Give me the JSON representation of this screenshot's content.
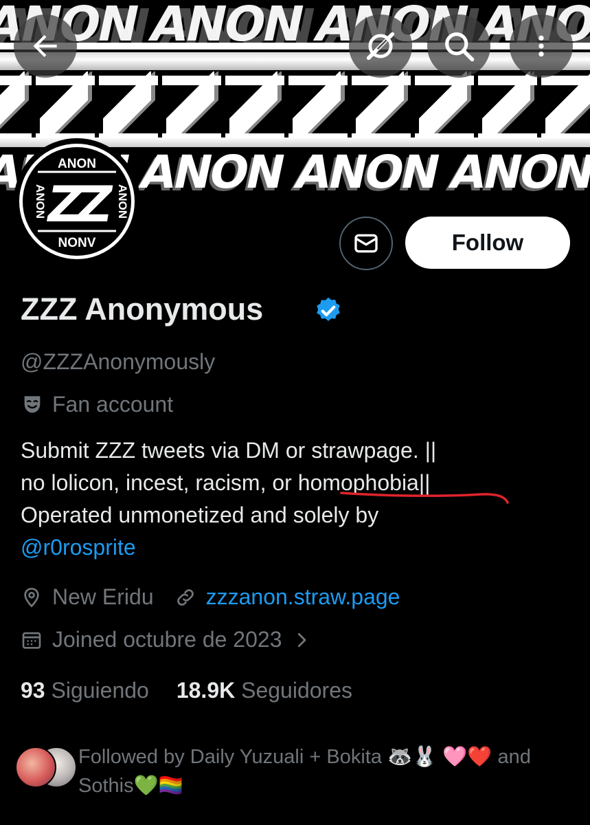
{
  "banner": {
    "top_text": "ANON ANON ANON ANON",
    "bottom_text": "ANON ANON ANON ANON"
  },
  "nav": {
    "back_icon": "arrow-left-icon",
    "grok_icon": "grok-icon",
    "search_icon": "search-icon",
    "more_icon": "more-vertical-icon"
  },
  "avatar": {
    "top_text": "ANON",
    "bottom_text": "NONV",
    "left_text": "ANON",
    "right_text": "ANON",
    "center_text": "ZZ"
  },
  "actions": {
    "message_icon": "mail-icon",
    "follow_label": "Follow"
  },
  "profile": {
    "display_name": "ZZZ Anonymous",
    "verified_icon": "verified-badge-icon",
    "handle": "@ZZZAnonymously",
    "category_icon": "theater-mask-icon",
    "category": "Fan account",
    "bio": {
      "line1": "Submit ZZZ tweets via DM or strawpage.  ||",
      "line2": "no lolicon, incest, racism, or homophobia||",
      "line3": "Operated unmonetized and solely by",
      "mention": "@r0rosprite"
    },
    "location": "New Eridu",
    "website": "zzzanon.straw.page",
    "joined": "Joined octubre de 2023"
  },
  "stats": {
    "following_count": "93",
    "following_label": "Siguiendo",
    "followers_count": "18.9K",
    "followers_label": "Seguidores"
  },
  "followed_by": {
    "text": "Followed by Daily Yuzuali + Bokita 🦝🐰 🩷❤️ and Sothis💚🏳️‍🌈"
  },
  "colors": {
    "background": "#000000",
    "text": "#e7e9ea",
    "muted": "#71767b",
    "link": "#1d9bf0",
    "annotation": "#e0242b"
  }
}
